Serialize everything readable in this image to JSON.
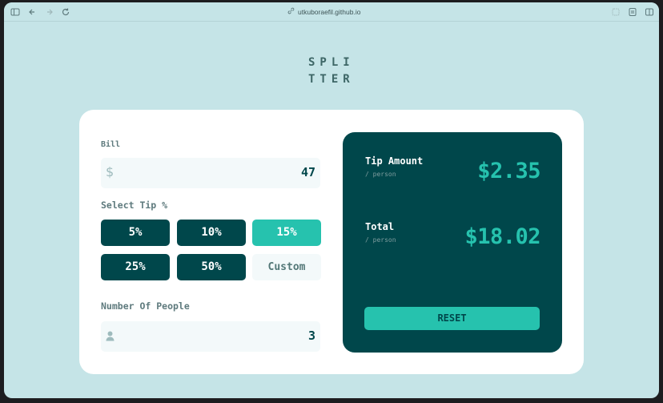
{
  "browser": {
    "url": "utkuboraefil.github.io",
    "icons": [
      "sidebar-icon",
      "back-icon",
      "forward-icon",
      "reload-icon",
      "link-icon",
      "extension-icon",
      "reader-icon",
      "tabs-icon"
    ]
  },
  "logo": {
    "line1": "SPLI",
    "line2": "TTER"
  },
  "bill": {
    "label": "Bill",
    "currency": "$",
    "value": "47"
  },
  "tip": {
    "label": "Select Tip %",
    "options": [
      "5%",
      "10%",
      "15%",
      "25%",
      "50%"
    ],
    "selected": "15%",
    "custom_placeholder": "Custom"
  },
  "people": {
    "label": "Number Of People",
    "value": "3"
  },
  "results": {
    "tip_title": "Tip Amount",
    "tip_sub": "/ person",
    "tip_value": "$2.35",
    "total_title": "Total",
    "total_sub": "/ person",
    "total_value": "$18.02",
    "reset_label": "RESET"
  },
  "colors": {
    "background": "#c5e4e7",
    "dark_cyan": "#00474b",
    "strong_cyan": "#26c2ae",
    "input_bg": "#f3f9fa"
  }
}
